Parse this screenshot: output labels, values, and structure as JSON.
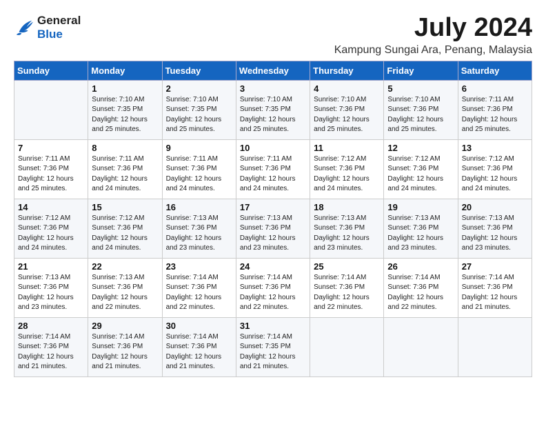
{
  "logo": {
    "line1": "General",
    "line2": "Blue"
  },
  "title": "July 2024",
  "location": "Kampung Sungai Ara, Penang, Malaysia",
  "weekdays": [
    "Sunday",
    "Monday",
    "Tuesday",
    "Wednesday",
    "Thursday",
    "Friday",
    "Saturday"
  ],
  "weeks": [
    [
      {
        "day": "",
        "sunrise": "",
        "sunset": "",
        "daylight": ""
      },
      {
        "day": "1",
        "sunrise": "Sunrise: 7:10 AM",
        "sunset": "Sunset: 7:35 PM",
        "daylight": "Daylight: 12 hours and 25 minutes."
      },
      {
        "day": "2",
        "sunrise": "Sunrise: 7:10 AM",
        "sunset": "Sunset: 7:35 PM",
        "daylight": "Daylight: 12 hours and 25 minutes."
      },
      {
        "day": "3",
        "sunrise": "Sunrise: 7:10 AM",
        "sunset": "Sunset: 7:35 PM",
        "daylight": "Daylight: 12 hours and 25 minutes."
      },
      {
        "day": "4",
        "sunrise": "Sunrise: 7:10 AM",
        "sunset": "Sunset: 7:36 PM",
        "daylight": "Daylight: 12 hours and 25 minutes."
      },
      {
        "day": "5",
        "sunrise": "Sunrise: 7:10 AM",
        "sunset": "Sunset: 7:36 PM",
        "daylight": "Daylight: 12 hours and 25 minutes."
      },
      {
        "day": "6",
        "sunrise": "Sunrise: 7:11 AM",
        "sunset": "Sunset: 7:36 PM",
        "daylight": "Daylight: 12 hours and 25 minutes."
      }
    ],
    [
      {
        "day": "7",
        "sunrise": "Sunrise: 7:11 AM",
        "sunset": "Sunset: 7:36 PM",
        "daylight": "Daylight: 12 hours and 25 minutes."
      },
      {
        "day": "8",
        "sunrise": "Sunrise: 7:11 AM",
        "sunset": "Sunset: 7:36 PM",
        "daylight": "Daylight: 12 hours and 24 minutes."
      },
      {
        "day": "9",
        "sunrise": "Sunrise: 7:11 AM",
        "sunset": "Sunset: 7:36 PM",
        "daylight": "Daylight: 12 hours and 24 minutes."
      },
      {
        "day": "10",
        "sunrise": "Sunrise: 7:11 AM",
        "sunset": "Sunset: 7:36 PM",
        "daylight": "Daylight: 12 hours and 24 minutes."
      },
      {
        "day": "11",
        "sunrise": "Sunrise: 7:12 AM",
        "sunset": "Sunset: 7:36 PM",
        "daylight": "Daylight: 12 hours and 24 minutes."
      },
      {
        "day": "12",
        "sunrise": "Sunrise: 7:12 AM",
        "sunset": "Sunset: 7:36 PM",
        "daylight": "Daylight: 12 hours and 24 minutes."
      },
      {
        "day": "13",
        "sunrise": "Sunrise: 7:12 AM",
        "sunset": "Sunset: 7:36 PM",
        "daylight": "Daylight: 12 hours and 24 minutes."
      }
    ],
    [
      {
        "day": "14",
        "sunrise": "Sunrise: 7:12 AM",
        "sunset": "Sunset: 7:36 PM",
        "daylight": "Daylight: 12 hours and 24 minutes."
      },
      {
        "day": "15",
        "sunrise": "Sunrise: 7:12 AM",
        "sunset": "Sunset: 7:36 PM",
        "daylight": "Daylight: 12 hours and 24 minutes."
      },
      {
        "day": "16",
        "sunrise": "Sunrise: 7:13 AM",
        "sunset": "Sunset: 7:36 PM",
        "daylight": "Daylight: 12 hours and 23 minutes."
      },
      {
        "day": "17",
        "sunrise": "Sunrise: 7:13 AM",
        "sunset": "Sunset: 7:36 PM",
        "daylight": "Daylight: 12 hours and 23 minutes."
      },
      {
        "day": "18",
        "sunrise": "Sunrise: 7:13 AM",
        "sunset": "Sunset: 7:36 PM",
        "daylight": "Daylight: 12 hours and 23 minutes."
      },
      {
        "day": "19",
        "sunrise": "Sunrise: 7:13 AM",
        "sunset": "Sunset: 7:36 PM",
        "daylight": "Daylight: 12 hours and 23 minutes."
      },
      {
        "day": "20",
        "sunrise": "Sunrise: 7:13 AM",
        "sunset": "Sunset: 7:36 PM",
        "daylight": "Daylight: 12 hours and 23 minutes."
      }
    ],
    [
      {
        "day": "21",
        "sunrise": "Sunrise: 7:13 AM",
        "sunset": "Sunset: 7:36 PM",
        "daylight": "Daylight: 12 hours and 23 minutes."
      },
      {
        "day": "22",
        "sunrise": "Sunrise: 7:13 AM",
        "sunset": "Sunset: 7:36 PM",
        "daylight": "Daylight: 12 hours and 22 minutes."
      },
      {
        "day": "23",
        "sunrise": "Sunrise: 7:14 AM",
        "sunset": "Sunset: 7:36 PM",
        "daylight": "Daylight: 12 hours and 22 minutes."
      },
      {
        "day": "24",
        "sunrise": "Sunrise: 7:14 AM",
        "sunset": "Sunset: 7:36 PM",
        "daylight": "Daylight: 12 hours and 22 minutes."
      },
      {
        "day": "25",
        "sunrise": "Sunrise: 7:14 AM",
        "sunset": "Sunset: 7:36 PM",
        "daylight": "Daylight: 12 hours and 22 minutes."
      },
      {
        "day": "26",
        "sunrise": "Sunrise: 7:14 AM",
        "sunset": "Sunset: 7:36 PM",
        "daylight": "Daylight: 12 hours and 22 minutes."
      },
      {
        "day": "27",
        "sunrise": "Sunrise: 7:14 AM",
        "sunset": "Sunset: 7:36 PM",
        "daylight": "Daylight: 12 hours and 21 minutes."
      }
    ],
    [
      {
        "day": "28",
        "sunrise": "Sunrise: 7:14 AM",
        "sunset": "Sunset: 7:36 PM",
        "daylight": "Daylight: 12 hours and 21 minutes."
      },
      {
        "day": "29",
        "sunrise": "Sunrise: 7:14 AM",
        "sunset": "Sunset: 7:36 PM",
        "daylight": "Daylight: 12 hours and 21 minutes."
      },
      {
        "day": "30",
        "sunrise": "Sunrise: 7:14 AM",
        "sunset": "Sunset: 7:36 PM",
        "daylight": "Daylight: 12 hours and 21 minutes."
      },
      {
        "day": "31",
        "sunrise": "Sunrise: 7:14 AM",
        "sunset": "Sunset: 7:35 PM",
        "daylight": "Daylight: 12 hours and 21 minutes."
      },
      {
        "day": "",
        "sunrise": "",
        "sunset": "",
        "daylight": ""
      },
      {
        "day": "",
        "sunrise": "",
        "sunset": "",
        "daylight": ""
      },
      {
        "day": "",
        "sunrise": "",
        "sunset": "",
        "daylight": ""
      }
    ]
  ]
}
